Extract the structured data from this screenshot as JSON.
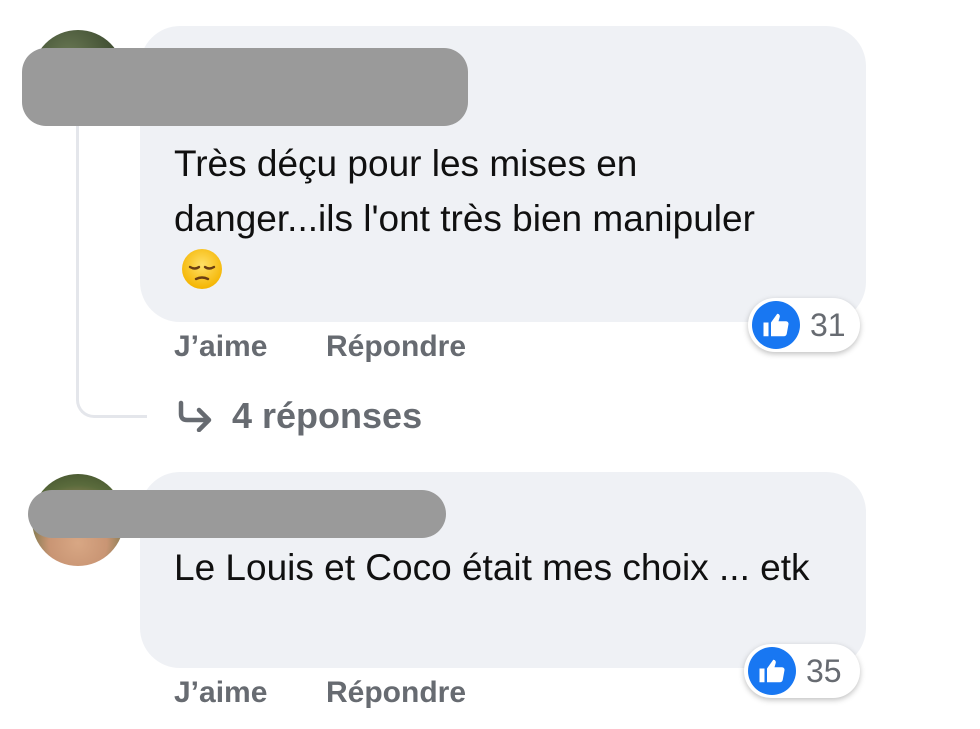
{
  "comments": [
    {
      "text": "Très déçu pour les mises en danger...ils l'ont très bien manipuler",
      "emoji": "pensive-face",
      "like_label": "J’aime",
      "reply_label": "Répondre",
      "reaction_count": "31",
      "replies_label": "4 réponses"
    },
    {
      "text": "Le Louis et Coco était mes choix ... etk",
      "like_label": "J’aime",
      "reply_label": "Répondre",
      "reaction_count": "35"
    }
  ],
  "colors": {
    "bubble": "#eff1f5",
    "like_blue": "#1877f2",
    "secondary_text": "#676b71",
    "redaction": "#9a9a9a"
  }
}
